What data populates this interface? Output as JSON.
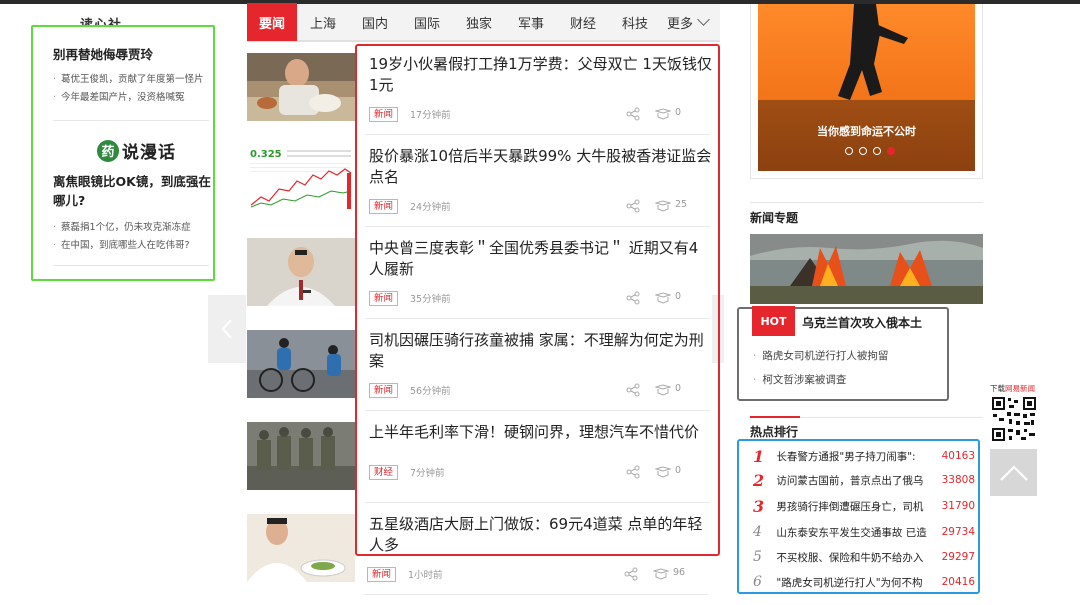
{
  "left_column": {
    "header": "读心社",
    "article1": {
      "title": "别再替她侮辱贾玲",
      "links": [
        "葛优王俊凯，贡献了年度第一怪片",
        "今年最差国产片，没资格喊冤"
      ]
    },
    "logo": {
      "icon_char": "药",
      "text": "说漫话"
    },
    "article2": {
      "title": "离焦眼镜比OK镜，到底强在哪儿?",
      "links": [
        "蔡磊捐1个亿，仍未攻克渐冻症",
        "在中国，到底哪些人在吃伟哥?"
      ]
    }
  },
  "nav": {
    "items": [
      "要闻",
      "上海",
      "国内",
      "国际",
      "独家",
      "军事",
      "财经",
      "科技"
    ],
    "active": "要闻",
    "more": "更多"
  },
  "news": [
    {
      "title": "19岁小伙暑假打工挣1万学费：父母双亡 1天饭钱仅1元",
      "tag": "新闻",
      "time": "17分钟前",
      "comments": "0"
    },
    {
      "title": "股价暴涨10倍后半天暴跌99% 大牛股被香港证监会点名",
      "tag": "新闻",
      "time": "24分钟前",
      "comments": "25"
    },
    {
      "title": "中央曾三度表彰＂全国优秀县委书记＂ 近期又有4人履新",
      "tag": "新闻",
      "time": "35分钟前",
      "comments": "0"
    },
    {
      "title": "司机因碾压骑行孩童被捕 家属：不理解为何定为刑案",
      "tag": "新闻",
      "time": "56分钟前",
      "comments": "0"
    },
    {
      "title": "上半年毛利率下滑！硬钢问界，理想汽车不惜代价",
      "tag": "财经",
      "time": "7分钟前",
      "comments": "0"
    },
    {
      "title": "五星级酒店大厨上门做饭：69元4道菜 点单的年轻人多",
      "tag": "新闻",
      "time": "1小时前",
      "comments": "96"
    }
  ],
  "stock_thumb": {
    "price": "0.325"
  },
  "banner": {
    "caption": "当你感到命运不公时",
    "dots": 4,
    "active_dot": 4
  },
  "news_topics": {
    "title": "新闻专题",
    "hot_badge": "HOT",
    "hot_title": "乌克兰首次攻入俄本土",
    "links": [
      "路虎女司机逆行打人被拘留",
      "柯文哲涉案被调查"
    ]
  },
  "hot_ranking": {
    "title": "热点排行",
    "items": [
      {
        "rank": "1",
        "text": "长春警方通报\"男子持刀闹事\":",
        "count": "40163"
      },
      {
        "rank": "2",
        "text": "访问蒙古国前，普京点出了俄乌",
        "count": "33808"
      },
      {
        "rank": "3",
        "text": "男孩骑行摔倒遭碾压身亡，司机",
        "count": "31790"
      },
      {
        "rank": "4",
        "text": "山东泰安东平发生交通事故 已造",
        "count": "29734"
      },
      {
        "rank": "5",
        "text": "不买校服、保险和牛奶不给办入",
        "count": "29297"
      },
      {
        "rank": "6",
        "text": "\"路虎女司机逆行打人\"为何不构",
        "count": "20416"
      }
    ]
  },
  "download": {
    "prefix": "下载",
    "brand": "网易新闻"
  },
  "colors": {
    "brand_red": "#e5262c",
    "left_highlight": "#5ddc3c",
    "rank_highlight": "#2b9ae0",
    "hot_box": "#6e6e6e"
  }
}
